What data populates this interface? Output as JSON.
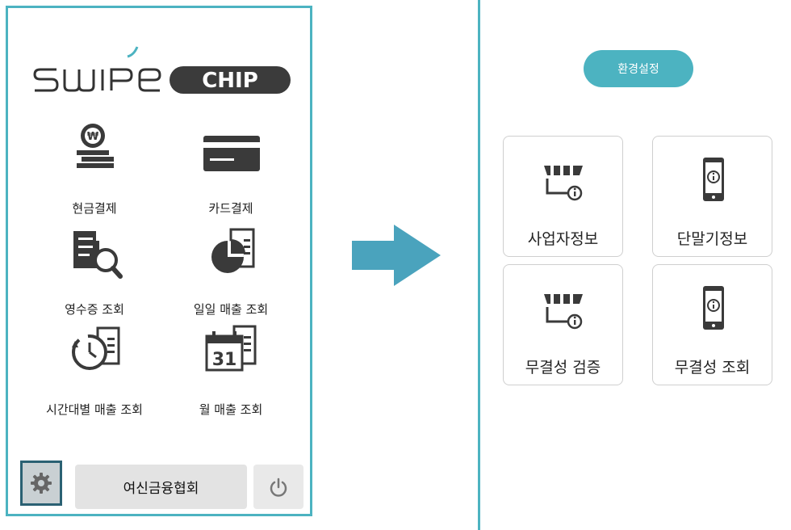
{
  "left": {
    "logo_text_swipe": "SWIPE",
    "logo_text_chip": "CHIP",
    "menu": [
      {
        "label": "현금결제",
        "icon": "cash-coin-icon"
      },
      {
        "label": "카드결제",
        "icon": "credit-card-icon"
      },
      {
        "label": "영수증 조회",
        "icon": "receipt-search-icon"
      },
      {
        "label": "일일 매출 조회",
        "icon": "pie-chart-document-icon"
      },
      {
        "label": "시간대별 매출 조회",
        "icon": "clock-document-icon"
      },
      {
        "label": "월 매출 조회",
        "icon": "calendar-document-icon"
      }
    ],
    "calendar_day": "31",
    "bottom": {
      "settings_icon": "gear-icon",
      "main_label": "여신금융협회",
      "power_icon": "power-icon"
    }
  },
  "arrow_icon": "right-arrow-icon",
  "right": {
    "settings_button": "환경설정",
    "cards": [
      {
        "label": "사업자정보",
        "icon": "store-info-icon"
      },
      {
        "label": "단말기정보",
        "icon": "phone-info-icon"
      },
      {
        "label": "무결성 검증",
        "icon": "store-info-icon"
      },
      {
        "label": "무결성 조회",
        "icon": "phone-info-icon"
      }
    ]
  },
  "colors": {
    "accent": "#4cb3c1",
    "icon_dark": "#3a3a3a",
    "selected_border": "#2b6173"
  }
}
